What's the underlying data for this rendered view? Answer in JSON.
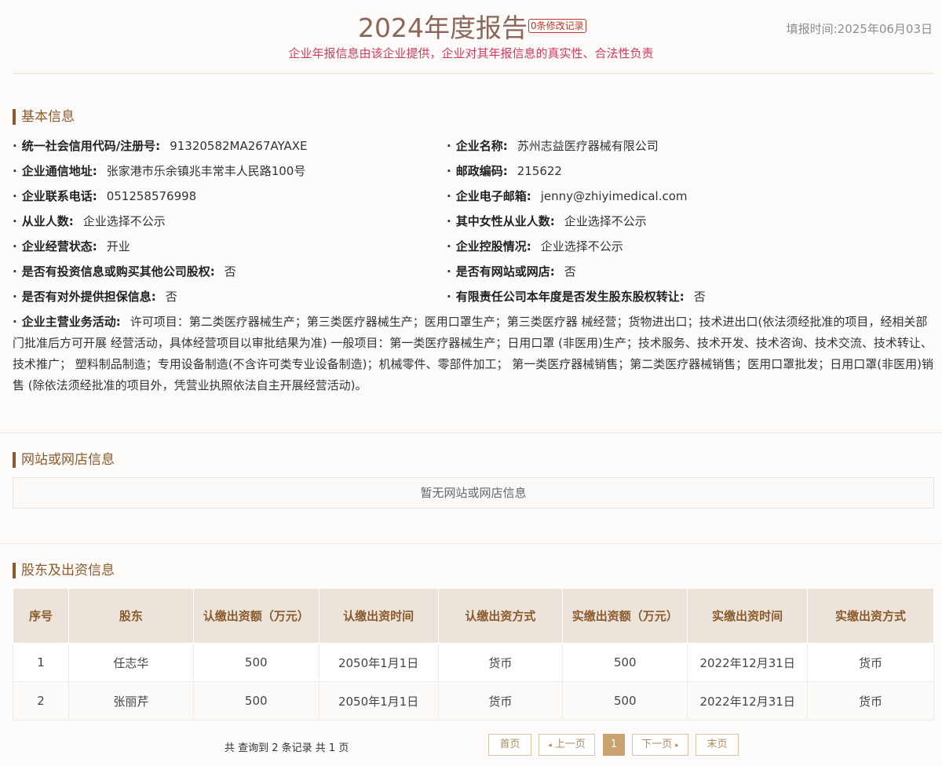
{
  "header": {
    "title": "2024年度报告",
    "revision_badge": "0条修改记录",
    "fill_time": "填报时间:2025年06月03日",
    "subtitle": "企业年报信息由该企业提供，企业对其年报信息的真实性、合法性负责"
  },
  "basic_info": {
    "section_title": "基本信息",
    "bullet": "·",
    "items": [
      {
        "label": "统一社会信用代码/注册号:",
        "value": "91320582MA267AYAXE"
      },
      {
        "label": "企业名称:",
        "value": "苏州志益医疗器械有限公司"
      },
      {
        "label": "企业通信地址:",
        "value": "张家港市乐余镇兆丰常丰人民路100号"
      },
      {
        "label": "邮政编码:",
        "value": "215622"
      },
      {
        "label": "企业联系电话:",
        "value": "051258576998"
      },
      {
        "label": "企业电子邮箱:",
        "value": "jenny@zhiyimedical.com"
      },
      {
        "label": "从业人数:",
        "value": "企业选择不公示"
      },
      {
        "label": "其中女性从业人数:",
        "value": "企业选择不公示"
      },
      {
        "label": "企业经营状态:",
        "value": "开业"
      },
      {
        "label": "企业控股情况:",
        "value": "企业选择不公示"
      },
      {
        "label": "是否有投资信息或购买其他公司股权:",
        "value": "否"
      },
      {
        "label": "是否有网站或网店:",
        "value": "否"
      },
      {
        "label": "是否有对外提供担保信息:",
        "value": "否"
      },
      {
        "label": "有限责任公司本年度是否发生股东股权转让:",
        "value": "否"
      }
    ],
    "business_scope_label": "企业主营业务活动:",
    "business_scope_value": "许可项目：第二类医疗器械生产；第三类医疗器械生产；医用口罩生产；第三类医疗器 械经营；货物进出口；技术进出口(依法须经批准的项目，经相关部门批准后方可开展 经营活动，具体经营项目以审批结果为准) 一般项目：第一类医疗器械生产；日用口罩 (非医用)生产；技术服务、技术开发、技术咨询、技术交流、技术转让、技术推广； 塑料制品制造；专用设备制造(不含许可类专业设备制造)；机械零件、零部件加工； 第一类医疗器械销售；第二类医疗器械销售；医用口罩批发；日用口罩(非医用)销售 (除依法须经批准的项目外，凭营业执照依法自主开展经营活动)。"
  },
  "website": {
    "section_title": "网站或网店信息",
    "empty_text": "暂无网站或网店信息"
  },
  "shareholders": {
    "section_title": "股东及出资信息",
    "columns": [
      "序号",
      "股东",
      "认缴出资额（万元）",
      "认缴出资时间",
      "认缴出资方式",
      "实缴出资额（万元）",
      "实缴出资时间",
      "实缴出资方式"
    ],
    "rows": [
      [
        "1",
        "任志华",
        "500",
        "2050年1月1日",
        "货币",
        "500",
        "2022年12月31日",
        "货币"
      ],
      [
        "2",
        "张丽芹",
        "500",
        "2050年1月1日",
        "货币",
        "500",
        "2022年12月31日",
        "货币"
      ]
    ]
  },
  "pagination": {
    "summary": "共 查询到 2 条记录 共 1 页",
    "first": "首页",
    "prev": "上一页",
    "prev_arrow": "◂",
    "current": "1",
    "next": "下一页",
    "next_arrow": "▸",
    "last": "末页"
  }
}
